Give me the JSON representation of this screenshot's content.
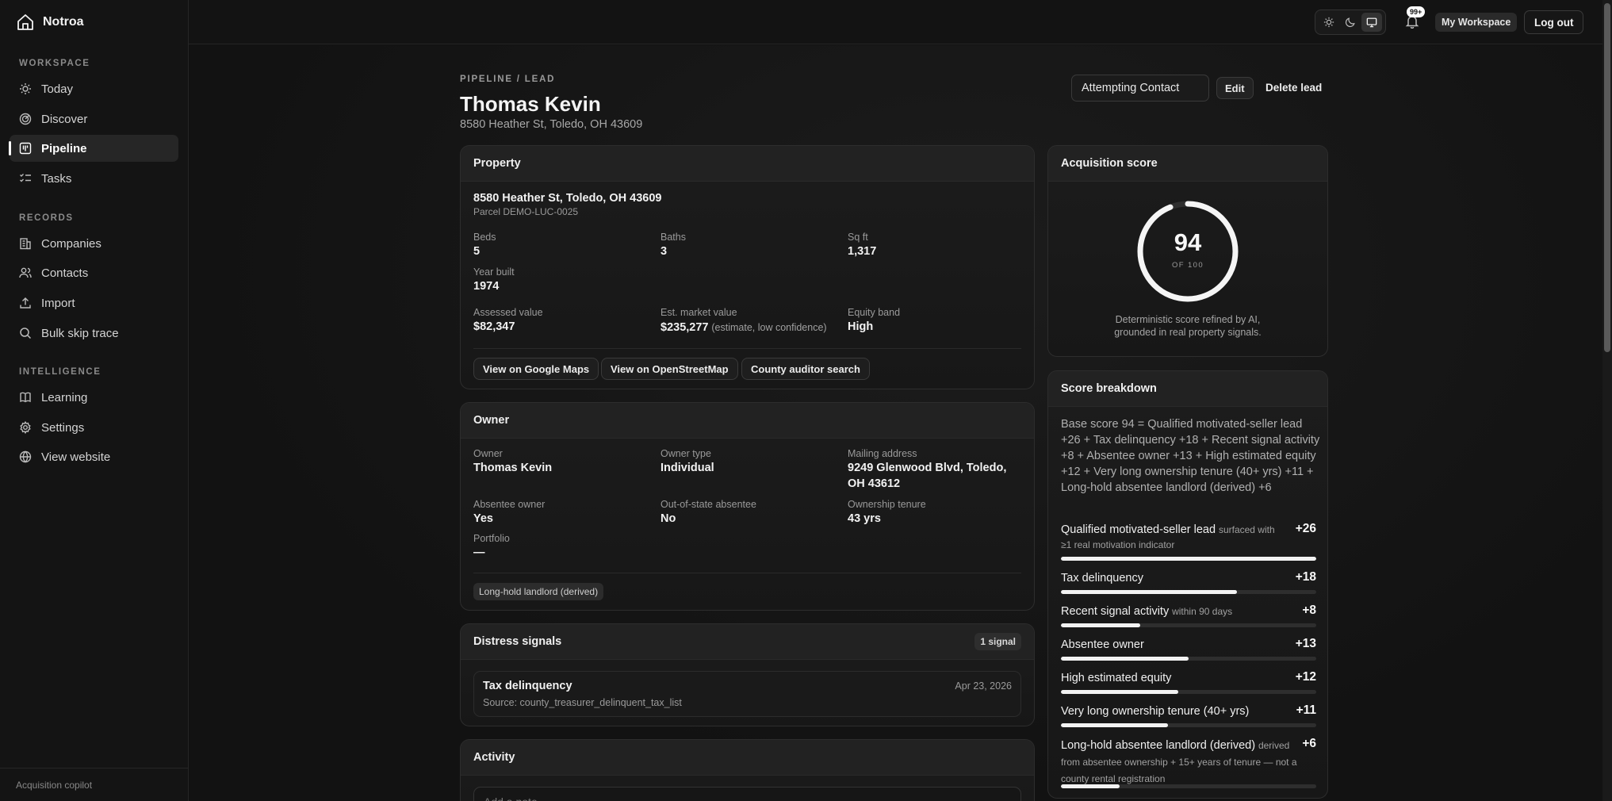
{
  "brand": {
    "name": "Notroa"
  },
  "sidebar": {
    "sections": [
      {
        "label": "WORKSPACE",
        "items": [
          {
            "label": "Today",
            "icon": "sun-icon"
          },
          {
            "label": "Discover",
            "icon": "radar-icon"
          },
          {
            "label": "Pipeline",
            "icon": "kanban-icon",
            "active": true
          },
          {
            "label": "Tasks",
            "icon": "checklist-icon"
          }
        ]
      },
      {
        "label": "RECORDS",
        "items": [
          {
            "label": "Companies",
            "icon": "building-icon"
          },
          {
            "label": "Contacts",
            "icon": "users-icon"
          },
          {
            "label": "Import",
            "icon": "upload-icon"
          },
          {
            "label": "Bulk skip trace",
            "icon": "search-icon"
          }
        ]
      },
      {
        "label": "INTELLIGENCE",
        "items": [
          {
            "label": "Learning",
            "icon": "book-icon"
          },
          {
            "label": "Settings",
            "icon": "gear-icon"
          },
          {
            "label": "View website",
            "icon": "globe-icon"
          }
        ]
      }
    ],
    "footer": "Acquisition copilot"
  },
  "topbar": {
    "theme_modes": [
      "light",
      "dark",
      "system"
    ],
    "theme_active": "system",
    "notification_badge": "99+",
    "workspace": "My Workspace",
    "logout": "Log out"
  },
  "header": {
    "breadcrumb": "PIPELINE / LEAD",
    "title": "Thomas Kevin",
    "subtitle": "8580 Heather St, Toledo, OH 43609",
    "status": "Attempting Contact",
    "edit": "Edit",
    "delete": "Delete lead"
  },
  "property": {
    "title": "Property",
    "address": "8580 Heather St, Toledo, OH 43609",
    "parcel": "Parcel DEMO-LUC-0025",
    "beds_label": "Beds",
    "beds": "5",
    "baths_label": "Baths",
    "baths": "3",
    "sqft_label": "Sq ft",
    "sqft": "1,317",
    "year_label": "Year built",
    "year": "1974",
    "assessed_label": "Assessed value",
    "assessed": "$82,347",
    "market_label": "Est. market value",
    "market": "$235,277",
    "market_note": "(estimate, low confidence)",
    "equity_label": "Equity band",
    "equity": "High",
    "links": [
      "View on Google Maps",
      "View on OpenStreetMap",
      "County auditor search"
    ]
  },
  "owner": {
    "title": "Owner",
    "owner_label": "Owner",
    "owner": "Thomas Kevin",
    "type_label": "Owner type",
    "type": "Individual",
    "mailing_label": "Mailing address",
    "mailing_line1": "9249 Glenwood Blvd, Toledo,",
    "mailing_line2": "OH 43612",
    "absentee_label": "Absentee owner",
    "absentee": "Yes",
    "oos_label": "Out-of-state absentee",
    "oos": "No",
    "tenure_label": "Ownership tenure",
    "tenure": "43 yrs",
    "portfolio_label": "Portfolio",
    "portfolio": "—",
    "tag": "Long-hold landlord (derived)"
  },
  "distress": {
    "title": "Distress signals",
    "count": "1 signal",
    "signal_name": "Tax delinquency",
    "signal_source": "Source: county_treasurer_delinquent_tax_list",
    "signal_date": "Apr 23, 2026"
  },
  "activity": {
    "title": "Activity",
    "placeholder": "Add a note..."
  },
  "acquisition": {
    "title": "Acquisition score",
    "score": 94,
    "score_text": "94",
    "max_text": "OF 100",
    "caption_line1": "Deterministic score refined by AI,",
    "caption_line2": "grounded in real property signals."
  },
  "breakdown": {
    "title": "Score breakdown",
    "summary": "Base score 94 = Qualified motivated-seller lead +26 + Tax delinquency +18 + Recent signal activity +8 + Absentee owner +13 + High estimated equity +12 + Very long ownership tenure (40+ yrs) +11 + Long-hold absentee landlord (derived) +6",
    "items": [
      {
        "name": "Qualified motivated-seller lead",
        "desc": "surfaced with ≥1 real motivation indicator",
        "points": "+26",
        "fraction": 1.0
      },
      {
        "name": "Tax delinquency",
        "desc": "",
        "points": "+18",
        "fraction": 0.69
      },
      {
        "name": "Recent signal activity",
        "desc": "within 90 days",
        "points": "+8",
        "fraction": 0.31
      },
      {
        "name": "Absentee owner",
        "desc": "",
        "points": "+13",
        "fraction": 0.5
      },
      {
        "name": "High estimated equity",
        "desc": "",
        "points": "+12",
        "fraction": 0.46
      },
      {
        "name": "Very long ownership tenure (40+ yrs)",
        "desc": "",
        "points": "+11",
        "fraction": 0.42
      },
      {
        "name": "Long-hold absentee landlord (derived)",
        "desc": "derived from absentee ownership + 15+ years of tenure — not a county rental registration",
        "points": "+6",
        "fraction": 0.23
      }
    ]
  }
}
